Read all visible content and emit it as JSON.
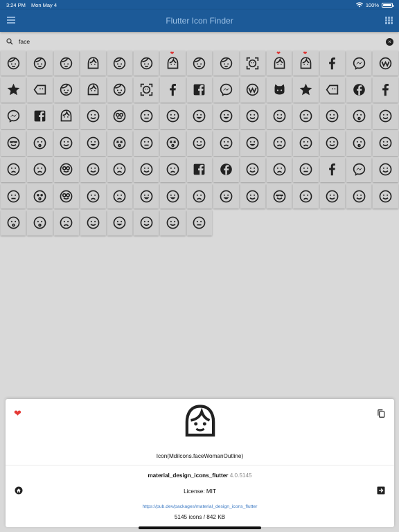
{
  "status": {
    "time": "3:24 PM",
    "date": "Mon May 4",
    "battery": "100%",
    "battery_level": 1.0
  },
  "app": {
    "title": "Flutter Icon Finder",
    "menu_icon": "menu-icon",
    "view_icon": "grid-view-icon"
  },
  "search": {
    "value": "face",
    "placeholder": "",
    "search_icon": "magnify-icon",
    "clear_icon": "close-circle-icon"
  },
  "icons": [
    {
      "name": "face-outline-icon",
      "fav": false
    },
    {
      "name": "face-smile-icon",
      "fav": false
    },
    {
      "name": "face-baby-icon",
      "fav": false
    },
    {
      "name": "face-child-icon",
      "fav": false
    },
    {
      "name": "face-man-outline-icon",
      "fav": false
    },
    {
      "name": "face-agent-icon",
      "fav": false
    },
    {
      "name": "face-woman-shimmer-icon",
      "fav": true
    },
    {
      "name": "face-man-icon",
      "fav": false
    },
    {
      "name": "face-profile-icon",
      "fav": false
    },
    {
      "name": "face-recognition-icon",
      "fav": false
    },
    {
      "name": "face-woman-icon",
      "fav": true
    },
    {
      "name": "face-woman-outline-icon",
      "fav": true
    },
    {
      "name": "facebook-icon",
      "fav": false
    },
    {
      "name": "facebook-messenger-icon",
      "fav": false
    },
    {
      "name": "facebook-workplace-icon",
      "fav": false
    },
    {
      "name": "star-face-icon",
      "fav": false
    },
    {
      "name": "tag-faces-icon",
      "fav": false
    },
    {
      "name": "face-man-profile-icon",
      "fav": false
    },
    {
      "name": "face-woman-profile-icon",
      "fav": false
    },
    {
      "name": "face-man-shimmer-icon",
      "fav": false
    },
    {
      "name": "face-recognition-icon",
      "fav": false
    },
    {
      "name": "facebook-f-icon",
      "fav": false
    },
    {
      "name": "facebook-square-icon",
      "fav": false
    },
    {
      "name": "facebook-messenger-icon",
      "fav": false
    },
    {
      "name": "facebook-workplace-icon",
      "fav": false
    },
    {
      "name": "github-face-icon",
      "fav": false
    },
    {
      "name": "star-face-icon",
      "fav": false
    },
    {
      "name": "tag-faces-icon",
      "fav": false
    },
    {
      "name": "facebook-circle-icon",
      "fav": false
    },
    {
      "name": "facebook-f-icon",
      "fav": false
    },
    {
      "name": "facebook-messenger-icon",
      "fav": false
    },
    {
      "name": "facebook-square-icon",
      "fav": false
    },
    {
      "name": "face-child-outline-icon",
      "fav": false
    },
    {
      "name": "emoticon-icon",
      "fav": false
    },
    {
      "name": "emoticon-nerd-icon",
      "fav": false
    },
    {
      "name": "emoticon-neutral-icon",
      "fav": false
    },
    {
      "name": "emoticon-happy-icon",
      "fav": false
    },
    {
      "name": "emoticon-excited-icon",
      "fav": false
    },
    {
      "name": "emoticon-grin-icon",
      "fav": false
    },
    {
      "name": "emoticon-outline-icon",
      "fav": false
    },
    {
      "name": "emoticon-tired-icon",
      "fav": false
    },
    {
      "name": "emoticon-confused-icon",
      "fav": false
    },
    {
      "name": "emoticon-wink-icon",
      "fav": false
    },
    {
      "name": "emoticon-surprised-icon",
      "fav": false
    },
    {
      "name": "emoticon-tongue-icon",
      "fav": false
    },
    {
      "name": "emoticon-cool-icon",
      "fav": false
    },
    {
      "name": "emoticon-kiss-icon",
      "fav": false
    },
    {
      "name": "emoticon-devil-icon",
      "fav": false
    },
    {
      "name": "emoticon-lol-icon",
      "fav": false
    },
    {
      "name": "emoticon-dead-icon",
      "fav": false
    },
    {
      "name": "emoticon-neutral-outline-icon",
      "fav": false
    },
    {
      "name": "emoticon-dead-outline-icon",
      "fav": false
    },
    {
      "name": "emoticon-happy-outline-icon",
      "fav": false
    },
    {
      "name": "emoticon-cry-icon",
      "fav": false
    },
    {
      "name": "emoticon-excited-outline-icon",
      "fav": false
    },
    {
      "name": "emoticon-sick-icon",
      "fav": false
    },
    {
      "name": "emoticon-frown-icon",
      "fav": false
    },
    {
      "name": "emoticon-wink-outline-icon",
      "fav": false
    },
    {
      "name": "emoticon-kiss-outline-icon",
      "fav": false
    },
    {
      "name": "emoticon-love-icon",
      "fav": false
    },
    {
      "name": "emoticon-angry-icon",
      "fav": false
    },
    {
      "name": "emoticon-angry-outline-icon",
      "fav": false
    },
    {
      "name": "emoticon-nerd-outline-icon",
      "fav": false
    },
    {
      "name": "emoticon-poop-icon",
      "fav": false
    },
    {
      "name": "emoticon-sad-outline-icon",
      "fav": false
    },
    {
      "name": "emoticon-tongue-outline-icon",
      "fav": false
    },
    {
      "name": "emoticon-frown-outline-icon",
      "fav": false
    },
    {
      "name": "facebook-square-outline-icon",
      "fav": false
    },
    {
      "name": "facebook-circle-outline-icon",
      "fav": false
    },
    {
      "name": "emoticon-happy-face-icon",
      "fav": false
    },
    {
      "name": "emoticon-sad-icon",
      "fav": false
    },
    {
      "name": "emoticon-neutral-face-icon",
      "fav": false
    },
    {
      "name": "facebook-f-icon",
      "fav": false
    },
    {
      "name": "facebook-messenger-outline-icon",
      "fav": false
    },
    {
      "name": "emoticon-happy-outline-icon",
      "fav": false
    },
    {
      "name": "emoticon-confused-outline-icon",
      "fav": false
    },
    {
      "name": "emoticon-dead-outline-icon",
      "fav": false
    },
    {
      "name": "emoticon-nerd-outline-icon",
      "fav": false
    },
    {
      "name": "emoticon-angry-outline-icon",
      "fav": false
    },
    {
      "name": "emoticon-frown-outline-icon",
      "fav": false
    },
    {
      "name": "emoticon-excited-outline-icon",
      "fav": false
    },
    {
      "name": "emoticon-grin-outline-icon",
      "fav": false
    },
    {
      "name": "emoticon-cry-outline-icon",
      "fav": false
    },
    {
      "name": "emoticon-lol-outline-icon",
      "fav": false
    },
    {
      "name": "emoticon-tired-outline-icon",
      "fav": false
    },
    {
      "name": "emoticon-cool-outline-icon",
      "fav": false
    },
    {
      "name": "emoticon-sick-outline-icon",
      "fav": false
    },
    {
      "name": "emoticon-devil-outline-icon",
      "fav": false
    },
    {
      "name": "emoticon-tongue-outline-icon",
      "fav": false
    },
    {
      "name": "emoticon-wink-outline-icon",
      "fav": false
    },
    {
      "name": "emoticon-kiss-outline-icon",
      "fav": false
    },
    {
      "name": "emoticon-kiss-face-icon",
      "fav": false
    },
    {
      "name": "emoticon-sick-face-icon",
      "fav": false
    },
    {
      "name": "emoticon-outline-icon",
      "fav": false
    },
    {
      "name": "emoticon-excited-face-icon",
      "fav": false
    },
    {
      "name": "emoticon-happy-icon",
      "fav": false
    },
    {
      "name": "emoticon-happy-face-icon",
      "fav": false
    },
    {
      "name": "emoticon-neutral-outline-icon",
      "fav": false
    }
  ],
  "detail": {
    "fav_icon": "heart-icon",
    "copy_icon": "content-copy-icon",
    "preview_icon": "face-woman-outline-icon",
    "code": "Icon(MdiIcons.faceWomanOutline)",
    "package_name": "material_design_icons_flutter",
    "package_version": "4.0.5145",
    "home_icon": "home-icon",
    "open_icon": "arrow-right-box-icon",
    "license": "License: MIT",
    "url": "https://pub.dev/packages/material_design_icons_flutter",
    "stats": "5145 icons / 842 KB"
  },
  "colors": {
    "appbar": "#1c5a98",
    "favorite": "#e53935",
    "link": "#3a78c2"
  }
}
